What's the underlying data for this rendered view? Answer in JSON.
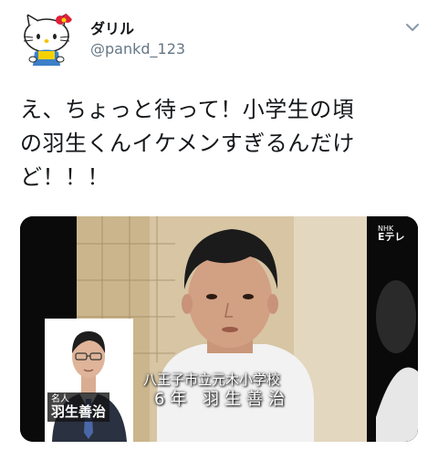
{
  "author": {
    "display_name": "ダリル",
    "handle": "@pankd_123",
    "avatar_icon": "hello-kitty-avatar-icon"
  },
  "menu": {
    "icon": "chevron-down-icon"
  },
  "tweet": {
    "lines": [
      "え、ちょっと待って！小学生の頃",
      "の羽生くんイケメンすぎるんだけ",
      "ど！！！"
    ]
  },
  "media": {
    "caption_line1": "八王子市立元木小学校",
    "caption_line2": "6年 羽生善治",
    "inset_title": "名人",
    "inset_name": "羽生善治",
    "channel_logo": "Eテレ",
    "channel_logo_small": "NHK"
  },
  "colors": {
    "text": "#14171a",
    "secondary": "#657786",
    "media_bg": "#0a0a0a"
  }
}
